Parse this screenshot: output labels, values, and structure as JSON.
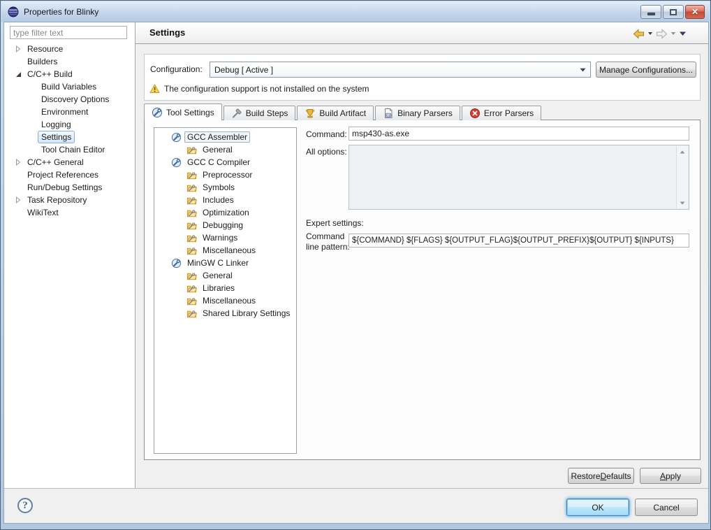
{
  "window": {
    "title": "Properties for Blinky",
    "controls": [
      "minimize-icon",
      "maximize-icon",
      "close-icon"
    ]
  },
  "colors": {
    "titlebar": "#c2d4ea",
    "selection_fill": "#d2e7f8",
    "selection_border": "#84acdd",
    "warning": "#f2c23e",
    "error": "#d63a34",
    "default_button_border": "#3c7fb1"
  },
  "sidebar": {
    "filter_placeholder": "type filter text",
    "items": [
      {
        "label": "Resource",
        "indent": 0,
        "arrow": "collapsed"
      },
      {
        "label": "Builders",
        "indent": 0,
        "arrow": "none"
      },
      {
        "label": "C/C++ Build",
        "indent": 0,
        "arrow": "expanded"
      },
      {
        "label": "Build Variables",
        "indent": 1,
        "arrow": "none"
      },
      {
        "label": "Discovery Options",
        "indent": 1,
        "arrow": "none"
      },
      {
        "label": "Environment",
        "indent": 1,
        "arrow": "none"
      },
      {
        "label": "Logging",
        "indent": 1,
        "arrow": "none"
      },
      {
        "label": "Settings",
        "indent": 1,
        "arrow": "none",
        "selected": true
      },
      {
        "label": "Tool Chain Editor",
        "indent": 1,
        "arrow": "none"
      },
      {
        "label": "C/C++ General",
        "indent": 0,
        "arrow": "collapsed"
      },
      {
        "label": "Project References",
        "indent": 0,
        "arrow": "none"
      },
      {
        "label": "Run/Debug Settings",
        "indent": 0,
        "arrow": "none"
      },
      {
        "label": "Task Repository",
        "indent": 0,
        "arrow": "collapsed"
      },
      {
        "label": "WikiText",
        "indent": 0,
        "arrow": "none"
      }
    ]
  },
  "header": {
    "title": "Settings"
  },
  "config": {
    "label": "Configuration:",
    "value": "Debug  [ Active ]",
    "manage_button": "Manage Configurations...",
    "warning": "The configuration support is not installed on the system"
  },
  "tabs": [
    {
      "label": "Tool Settings",
      "icon": "tools",
      "active": true
    },
    {
      "label": "Build Steps",
      "icon": "hammer"
    },
    {
      "label": "Build Artifact",
      "icon": "trophy"
    },
    {
      "label": "Binary Parsers",
      "icon": "binary"
    },
    {
      "label": "Error Parsers",
      "icon": "error"
    }
  ],
  "tool_tree": [
    {
      "label": "GCC Assembler",
      "icon": "tool",
      "indent": 0,
      "selected": true
    },
    {
      "label": "General",
      "icon": "category",
      "indent": 1
    },
    {
      "label": "GCC C Compiler",
      "icon": "tool",
      "indent": 0
    },
    {
      "label": "Preprocessor",
      "icon": "category",
      "indent": 1
    },
    {
      "label": "Symbols",
      "icon": "category",
      "indent": 1
    },
    {
      "label": "Includes",
      "icon": "category",
      "indent": 1
    },
    {
      "label": "Optimization",
      "icon": "category",
      "indent": 1
    },
    {
      "label": "Debugging",
      "icon": "category",
      "indent": 1
    },
    {
      "label": "Warnings",
      "icon": "category",
      "indent": 1
    },
    {
      "label": "Miscellaneous",
      "icon": "category",
      "indent": 1
    },
    {
      "label": "MinGW C Linker",
      "icon": "tool",
      "indent": 0
    },
    {
      "label": "General",
      "icon": "category",
      "indent": 1
    },
    {
      "label": "Libraries",
      "icon": "category",
      "indent": 1
    },
    {
      "label": "Miscellaneous",
      "icon": "category",
      "indent": 1
    },
    {
      "label": "Shared Library Settings",
      "icon": "category",
      "indent": 1
    }
  ],
  "form": {
    "command_label": "Command:",
    "command_value": "msp430-as.exe",
    "all_options_label": "All options:",
    "all_options_value": "",
    "expert_label": "Expert settings:",
    "pattern_label_line1": "Command",
    "pattern_label_line2": "line pattern:",
    "pattern_value": "${COMMAND} ${FLAGS} ${OUTPUT_FLAG}${OUTPUT_PREFIX}${OUTPUT} ${INPUTS}"
  },
  "buttons": {
    "restore": {
      "pre": "Restore ",
      "u": "D",
      "post": "efaults"
    },
    "apply": {
      "pre": "",
      "u": "A",
      "post": "pply"
    },
    "ok": "OK",
    "cancel": "Cancel",
    "help": "?"
  }
}
